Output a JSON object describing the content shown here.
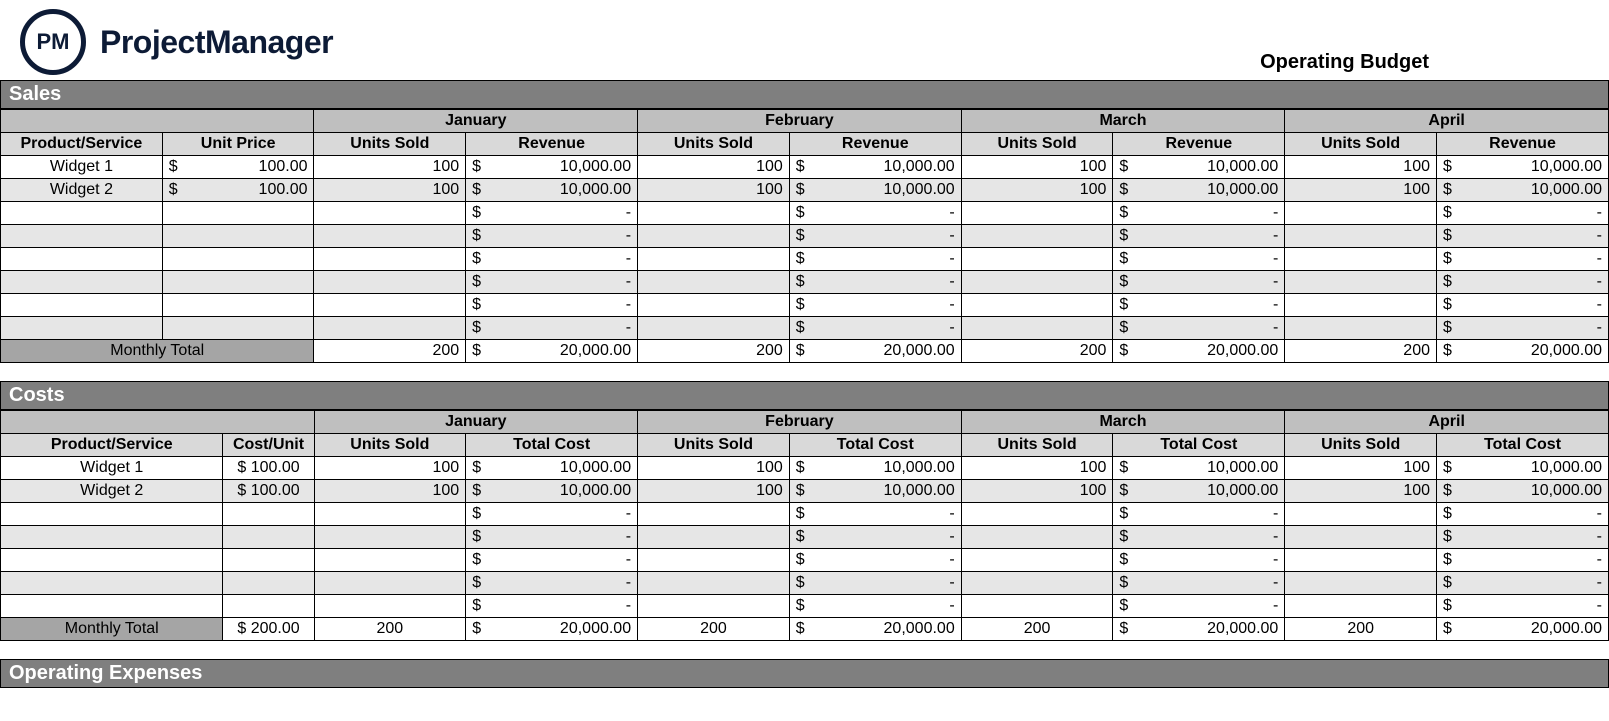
{
  "brand": "ProjectManager",
  "logo_text": "PM",
  "doc_title": "Operating Budget",
  "months": [
    "January",
    "February",
    "March",
    "April"
  ],
  "sales": {
    "title": "Sales",
    "col_product": "Product/Service",
    "col_unit_price": "Unit Price",
    "col_units": "Units Sold",
    "col_revenue": "Revenue",
    "rows": [
      {
        "name": "Widget 1",
        "unit_price": "100.00",
        "months": [
          {
            "units": "100",
            "rev": "10,000.00"
          },
          {
            "units": "100",
            "rev": "10,000.00"
          },
          {
            "units": "100",
            "rev": "10,000.00"
          },
          {
            "units": "100",
            "rev": "10,000.00"
          }
        ]
      },
      {
        "name": "Widget 2",
        "unit_price": "100.00",
        "months": [
          {
            "units": "100",
            "rev": "10,000.00"
          },
          {
            "units": "100",
            "rev": "10,000.00"
          },
          {
            "units": "100",
            "rev": "10,000.00"
          },
          {
            "units": "100",
            "rev": "10,000.00"
          }
        ]
      },
      {
        "name": "",
        "unit_price": "",
        "months": [
          {
            "units": "",
            "rev": "-"
          },
          {
            "units": "",
            "rev": "-"
          },
          {
            "units": "",
            "rev": "-"
          },
          {
            "units": "",
            "rev": "-"
          }
        ]
      },
      {
        "name": "",
        "unit_price": "",
        "months": [
          {
            "units": "",
            "rev": "-"
          },
          {
            "units": "",
            "rev": "-"
          },
          {
            "units": "",
            "rev": "-"
          },
          {
            "units": "",
            "rev": "-"
          }
        ]
      },
      {
        "name": "",
        "unit_price": "",
        "months": [
          {
            "units": "",
            "rev": "-"
          },
          {
            "units": "",
            "rev": "-"
          },
          {
            "units": "",
            "rev": "-"
          },
          {
            "units": "",
            "rev": "-"
          }
        ]
      },
      {
        "name": "",
        "unit_price": "",
        "months": [
          {
            "units": "",
            "rev": "-"
          },
          {
            "units": "",
            "rev": "-"
          },
          {
            "units": "",
            "rev": "-"
          },
          {
            "units": "",
            "rev": "-"
          }
        ]
      },
      {
        "name": "",
        "unit_price": "",
        "months": [
          {
            "units": "",
            "rev": "-"
          },
          {
            "units": "",
            "rev": "-"
          },
          {
            "units": "",
            "rev": "-"
          },
          {
            "units": "",
            "rev": "-"
          }
        ]
      },
      {
        "name": "",
        "unit_price": "",
        "months": [
          {
            "units": "",
            "rev": "-"
          },
          {
            "units": "",
            "rev": "-"
          },
          {
            "units": "",
            "rev": "-"
          },
          {
            "units": "",
            "rev": "-"
          }
        ]
      }
    ],
    "total_label": "Monthly Total",
    "totals": [
      {
        "units": "200",
        "rev": "20,000.00"
      },
      {
        "units": "200",
        "rev": "20,000.00"
      },
      {
        "units": "200",
        "rev": "20,000.00"
      },
      {
        "units": "200",
        "rev": "20,000.00"
      }
    ]
  },
  "costs": {
    "title": "Costs",
    "col_product": "Product/Service",
    "col_cost_unit": "Cost/Unit",
    "col_units": "Units Sold",
    "col_total_cost": "Total Cost",
    "rows": [
      {
        "name": "Widget 1",
        "cost_unit": "$ 100.00",
        "months": [
          {
            "units": "100",
            "cost": "10,000.00"
          },
          {
            "units": "100",
            "cost": "10,000.00"
          },
          {
            "units": "100",
            "cost": "10,000.00"
          },
          {
            "units": "100",
            "cost": "10,000.00"
          }
        ]
      },
      {
        "name": "Widget 2",
        "cost_unit": "$ 100.00",
        "months": [
          {
            "units": "100",
            "cost": "10,000.00"
          },
          {
            "units": "100",
            "cost": "10,000.00"
          },
          {
            "units": "100",
            "cost": "10,000.00"
          },
          {
            "units": "100",
            "cost": "10,000.00"
          }
        ]
      },
      {
        "name": "",
        "cost_unit": "",
        "months": [
          {
            "units": "",
            "cost": "-"
          },
          {
            "units": "",
            "cost": "-"
          },
          {
            "units": "",
            "cost": "-"
          },
          {
            "units": "",
            "cost": "-"
          }
        ]
      },
      {
        "name": "",
        "cost_unit": "",
        "months": [
          {
            "units": "",
            "cost": "-"
          },
          {
            "units": "",
            "cost": "-"
          },
          {
            "units": "",
            "cost": "-"
          },
          {
            "units": "",
            "cost": "-"
          }
        ]
      },
      {
        "name": "",
        "cost_unit": "",
        "months": [
          {
            "units": "",
            "cost": "-"
          },
          {
            "units": "",
            "cost": "-"
          },
          {
            "units": "",
            "cost": "-"
          },
          {
            "units": "",
            "cost": "-"
          }
        ]
      },
      {
        "name": "",
        "cost_unit": "",
        "months": [
          {
            "units": "",
            "cost": "-"
          },
          {
            "units": "",
            "cost": "-"
          },
          {
            "units": "",
            "cost": "-"
          },
          {
            "units": "",
            "cost": "-"
          }
        ]
      },
      {
        "name": "",
        "cost_unit": "",
        "months": [
          {
            "units": "",
            "cost": "-"
          },
          {
            "units": "",
            "cost": "-"
          },
          {
            "units": "",
            "cost": "-"
          },
          {
            "units": "",
            "cost": "-"
          }
        ]
      }
    ],
    "total_label": "Monthly Total",
    "total_cost_unit": "$ 200.00",
    "totals": [
      {
        "units": "200",
        "cost": "20,000.00"
      },
      {
        "units": "200",
        "cost": "20,000.00"
      },
      {
        "units": "200",
        "cost": "20,000.00"
      },
      {
        "units": "200",
        "cost": "20,000.00"
      }
    ]
  },
  "opex": {
    "title": "Operating Expenses"
  }
}
